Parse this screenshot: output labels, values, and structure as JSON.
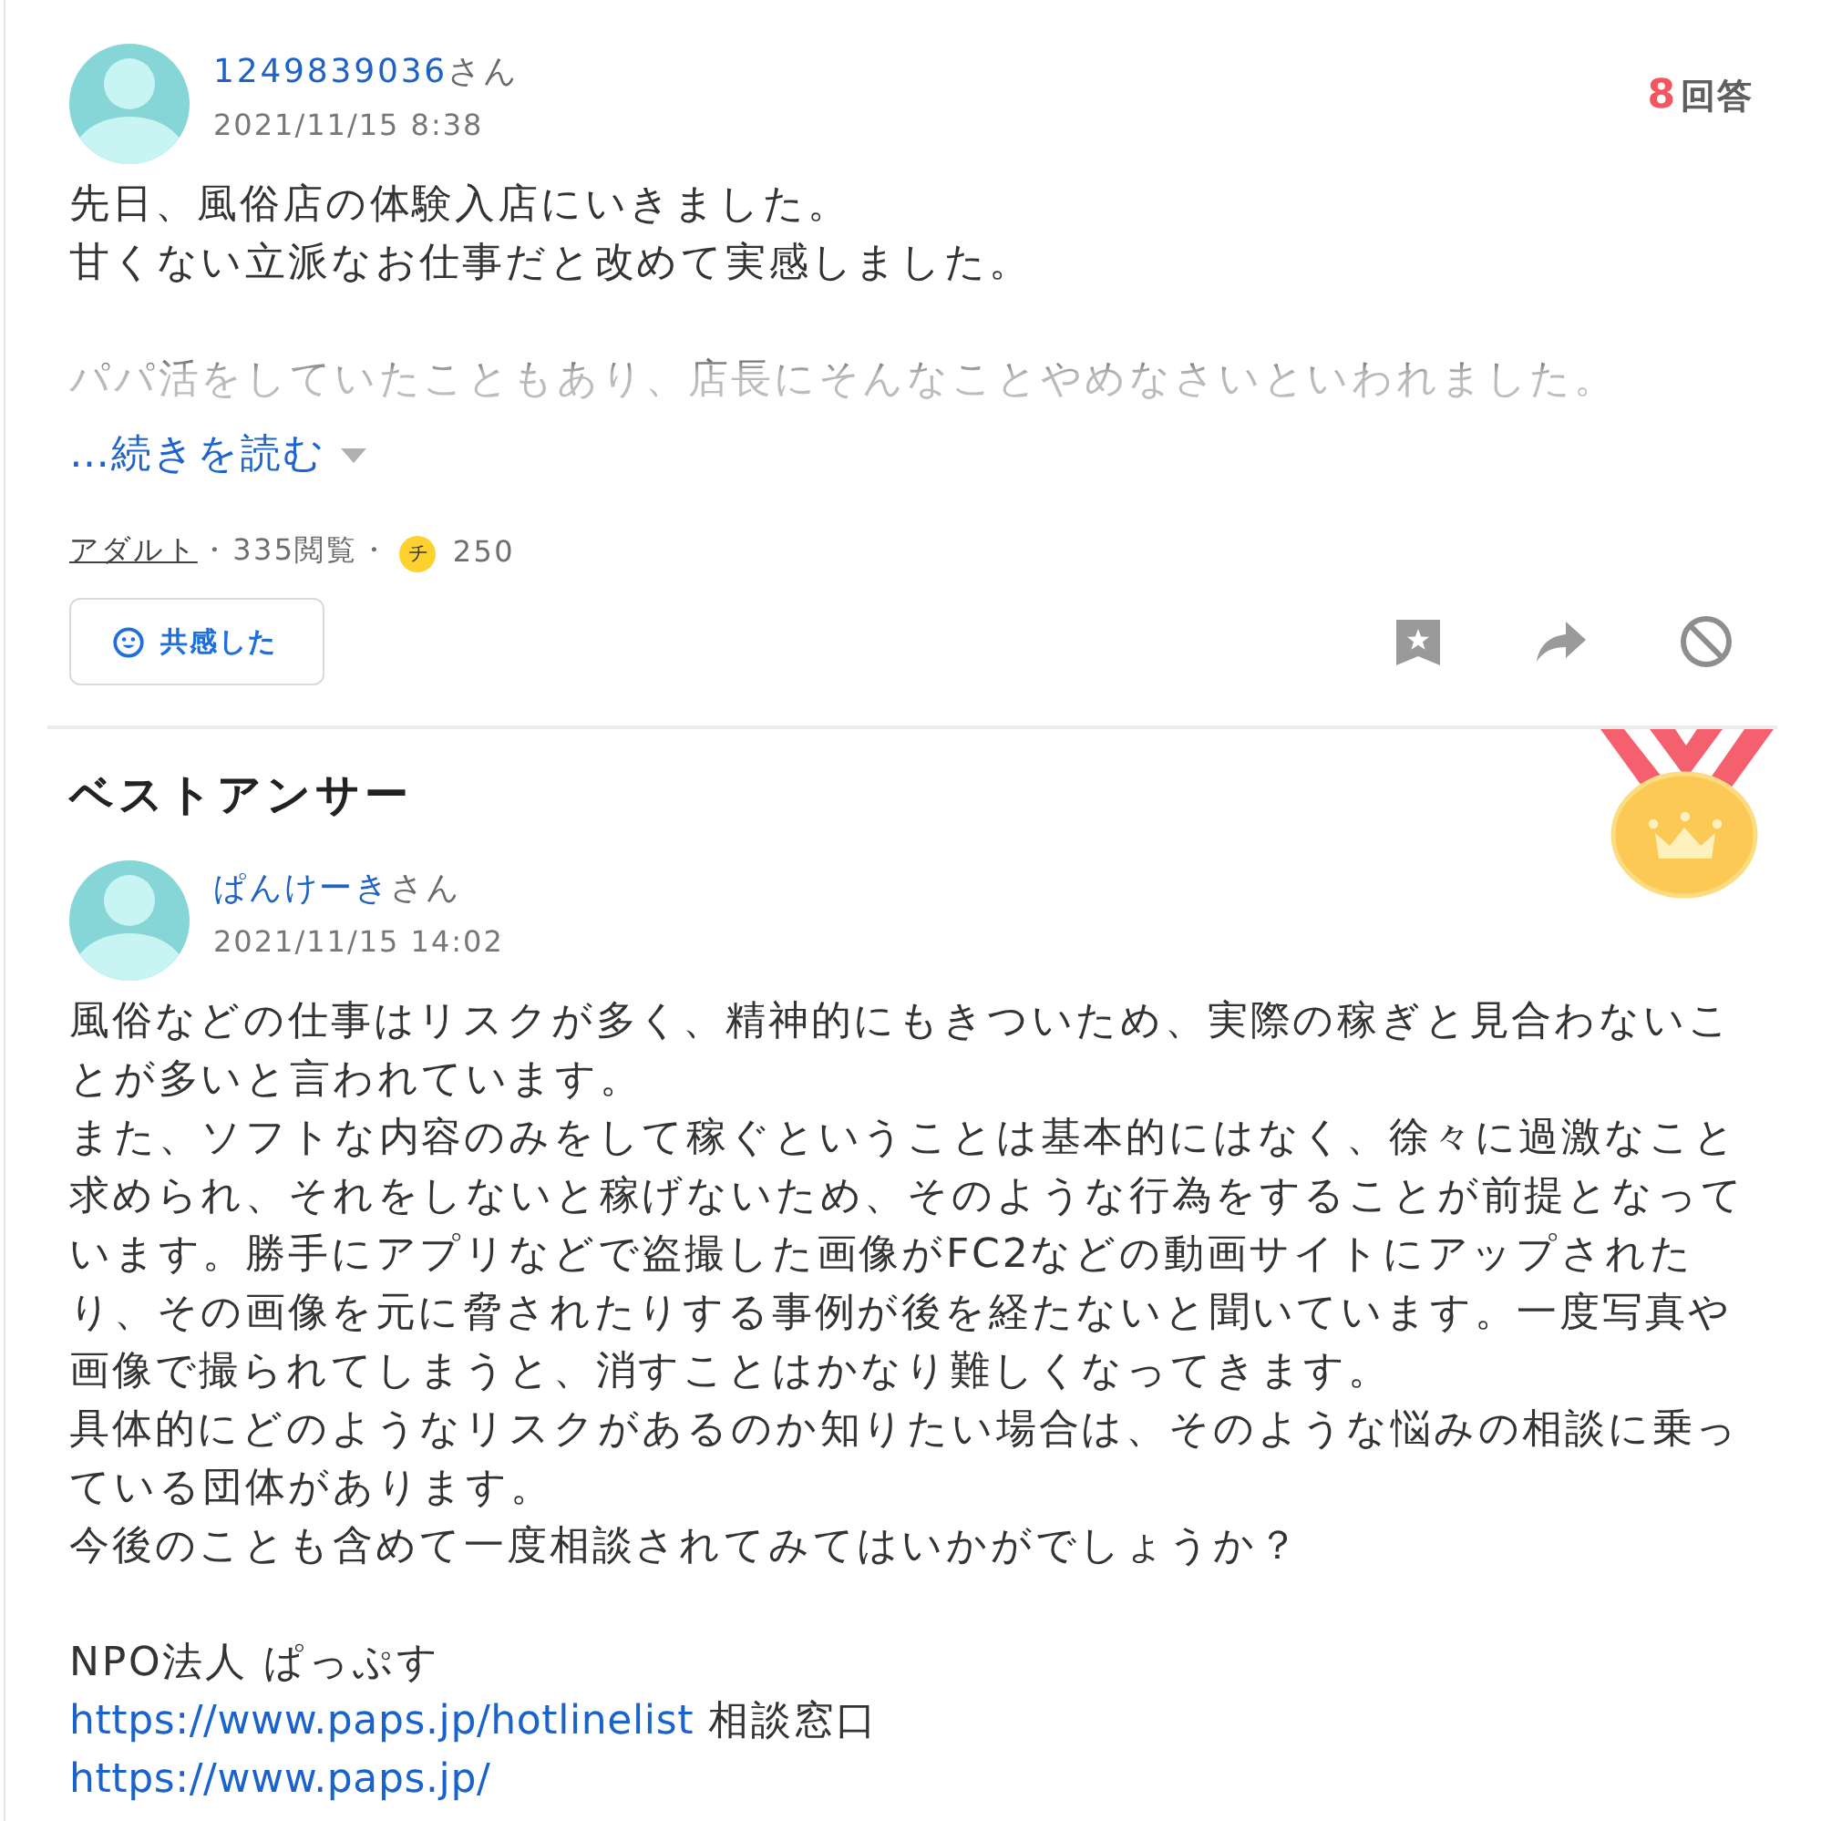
{
  "question": {
    "author": {
      "name": "1249839036",
      "suffix": "さん"
    },
    "date": "2021/11/15 8:38",
    "answer_count": {
      "number": "8",
      "label": "回答"
    },
    "collapsed": true,
    "body": [
      {
        "lines": [
          "先日、風俗店の体験入店にいきました。",
          "甘くない立派なお仕事だと改めて実感しました。"
        ]
      },
      {
        "lines": [
          "パパ活をしていたこともあり、店長にそんなことやめなさいといわれました。"
        ]
      }
    ],
    "read_more": "…続きを読む",
    "meta": {
      "category": "アダルト",
      "separator_1": "・",
      "views": "335閲覧",
      "separator_2": "・",
      "coin_mark": "チ",
      "coins": "250"
    },
    "reaction_button": "共感した"
  },
  "best_answer": {
    "heading": "ベストアンサー",
    "author": {
      "name": "ぱんけーき",
      "suffix": "さん"
    },
    "date": "2021/11/15 14:02",
    "body": [
      {
        "lines": [
          {
            "kind": "text",
            "text": "風俗などの仕事はリスクが多く、精神的にもきついため、実際の稼ぎと見合わないことが多いと言われています。"
          },
          {
            "kind": "text",
            "text": "また、ソフトな内容のみをして稼ぐということは基本的にはなく、徐々に過激なこと求められ、それをしないと稼げないため、そのような行為をすることが前提となっています。勝手にアプリなどで盗撮した画像がFC2などの動画サイトにアップされたり、その画像を元に脅されたりする事例が後を経たないと聞いています。一度写真や画像で撮られてしまうと、消すことはかなり難しくなってきます。"
          },
          {
            "kind": "text",
            "text": "具体的にどのようなリスクがあるのか知りたい場合は、そのような悩みの相談に乗っている団体があります。"
          },
          {
            "kind": "text",
            "text": "今後のことも含めて一度相談されてみてはいかがでしょうか？"
          }
        ]
      },
      {
        "lines": [
          {
            "kind": "text",
            "text": "NPO法人 ぱっぷす"
          },
          {
            "kind": "link",
            "url": "https://www.paps.jp/hotlinelist",
            "note": "相談窓口"
          },
          {
            "kind": "link",
            "url": "https://www.paps.jp/"
          }
        ]
      }
    ]
  }
}
